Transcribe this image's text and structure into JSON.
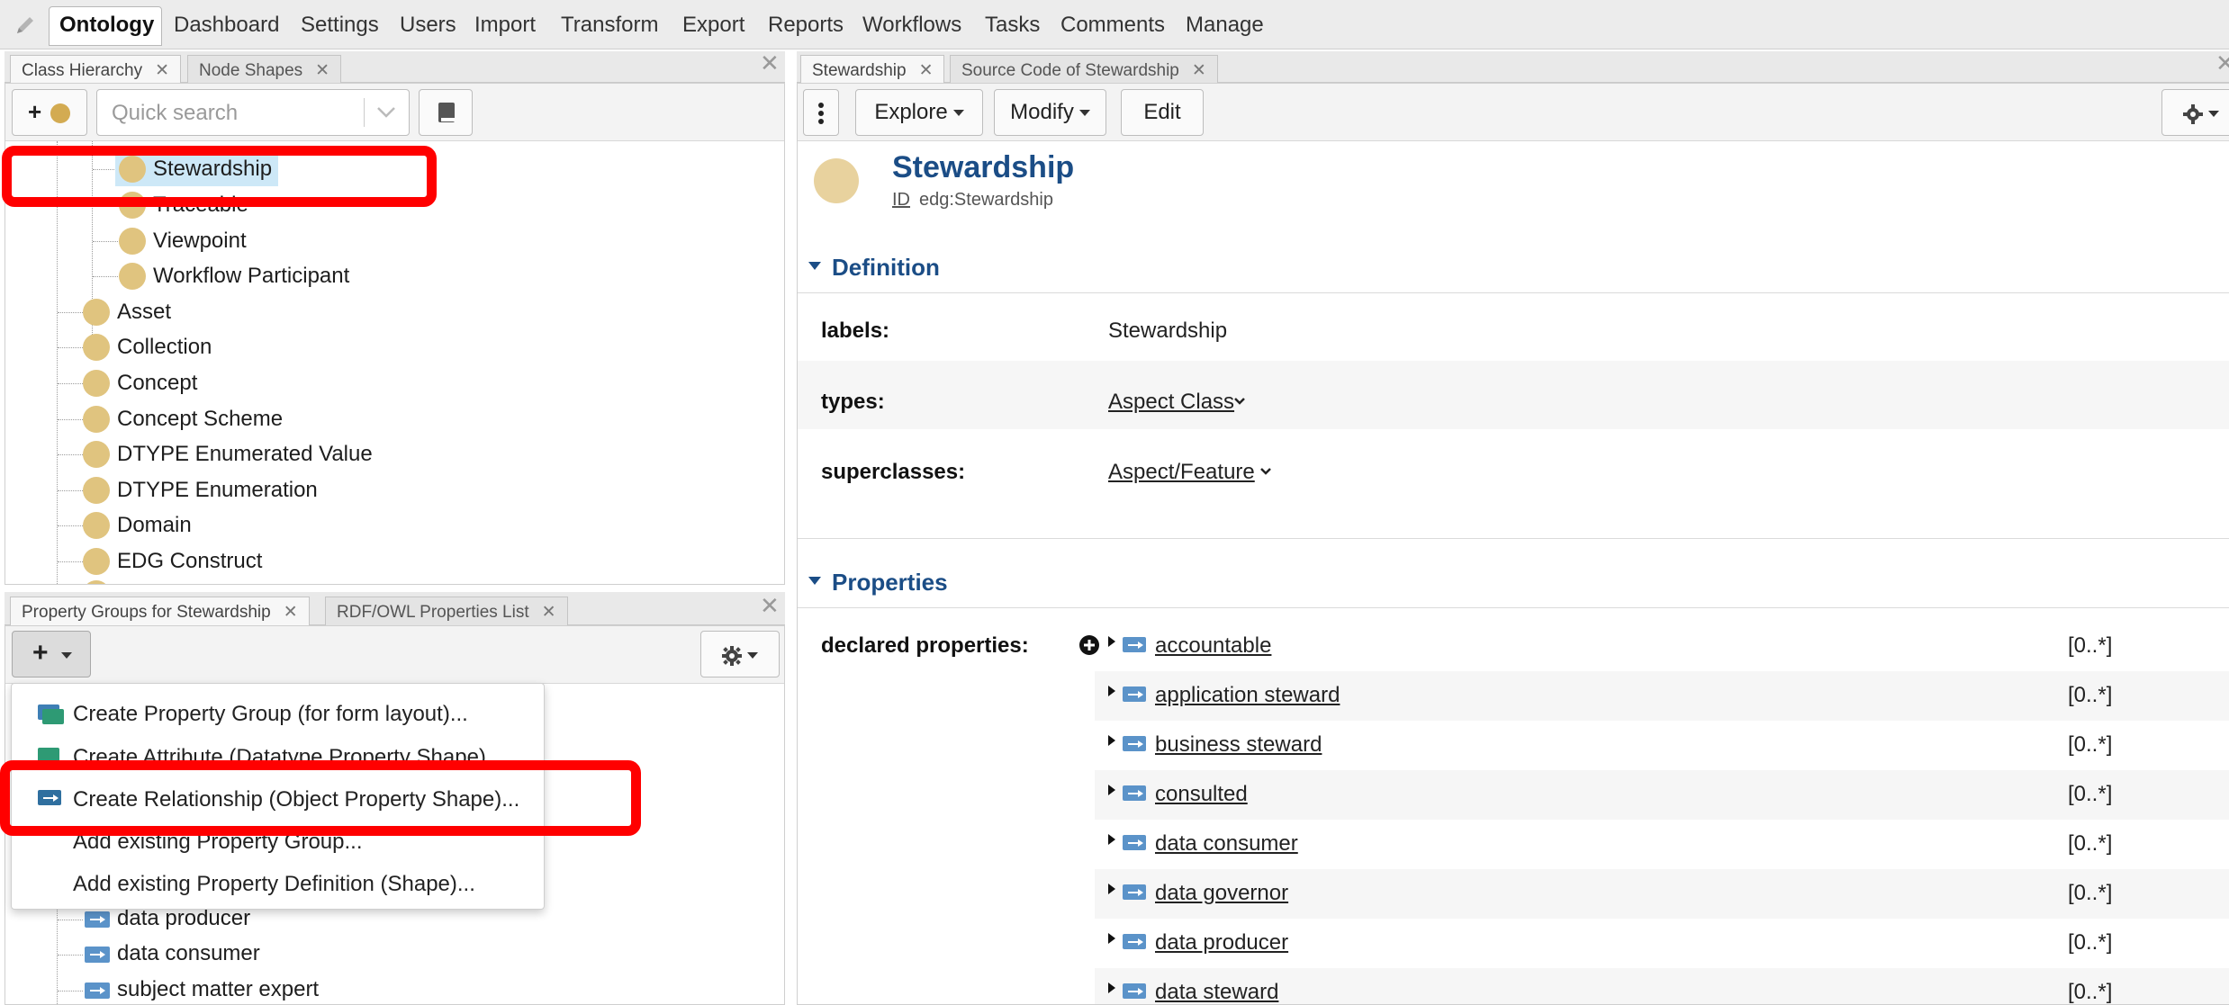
{
  "menu": {
    "active": "Ontology",
    "items": [
      "Dashboard",
      "Settings",
      "Users",
      "Import",
      "Transform",
      "Export",
      "Reports",
      "Workflows",
      "Tasks",
      "Comments",
      "Manage"
    ]
  },
  "class_panel": {
    "tabs": [
      "Class Hierarchy",
      "Node Shapes"
    ],
    "search_placeholder": "Quick search",
    "add_label": "+",
    "nested_items": [
      "Stewardship",
      "Traceable",
      "Viewpoint",
      "Workflow Participant"
    ],
    "root_items": [
      "Asset",
      "Collection",
      "Concept",
      "Concept Scheme",
      "DTYPE Enumerated Value",
      "DTYPE Enumeration",
      "Domain",
      "EDG Construct"
    ]
  },
  "property_panel": {
    "tabs": [
      "Property Groups for Stewardship",
      "RDF/OWL Properties List"
    ],
    "add_label": "+",
    "menu_items": [
      "Create Property Group (for form layout)...",
      "Create Attribute (Datatype Property Shape)...",
      "Create Relationship (Object Property Shape)...",
      "Add existing Property Group...",
      "Add existing Property Definition (Shape)..."
    ],
    "visible_properties": [
      "data producer",
      "data consumer",
      "subject matter expert"
    ]
  },
  "resource_panel": {
    "tabs": [
      "Stewardship",
      "Source Code of Stewardship"
    ],
    "toolbar": {
      "explore": "Explore",
      "modify": "Modify",
      "edit": "Edit"
    },
    "title": "Stewardship",
    "id_label": "ID",
    "id_value": "edg:Stewardship",
    "definition": {
      "header": "Definition",
      "labels_key": "labels:",
      "labels_value": "Stewardship",
      "types_key": "types:",
      "types_value": "Aspect Class",
      "superclasses_key": "superclasses:",
      "superclasses_value": "Aspect/Feature"
    },
    "properties": {
      "header": "Properties",
      "declared_key": "declared properties:",
      "cardinality": "[0..*]",
      "items": [
        "accountable",
        "application steward",
        "business steward",
        "consulted",
        "data consumer",
        "data governor",
        "data producer",
        "data steward"
      ]
    }
  },
  "colors": {
    "class_dot": "#e0c47f",
    "link": "#2f6fa6",
    "header_blue": "#1b4d86",
    "highlight": "#ff0000",
    "selected_bg": "#cde8f7"
  }
}
